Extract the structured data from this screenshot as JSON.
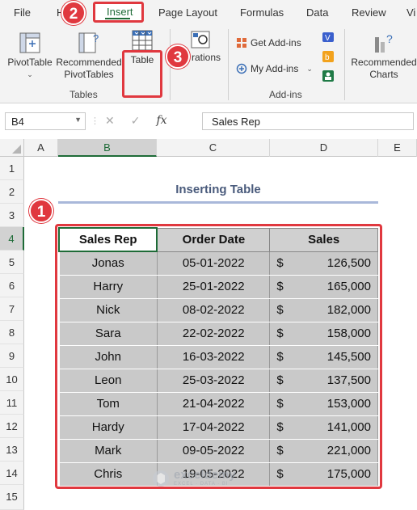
{
  "ribbon_tabs": {
    "file": "File",
    "home_partial": "H",
    "insert": "Insert",
    "page_layout": "Page Layout",
    "formulas": "Formulas",
    "data": "Data",
    "review": "Review",
    "view_partial": "Vi"
  },
  "ribbon": {
    "pivottable": "PivotTable",
    "recommended_pivottables_1": "Recommended",
    "recommended_pivottables_2": "PivotTables",
    "table": "Table",
    "illustrations_partial": "rations",
    "get_addins": "Get Add-ins",
    "my_addins": "My Add-ins",
    "recommended_charts_1": "Recommended",
    "recommended_charts_2": "Charts",
    "group_tables": "Tables",
    "group_addins": "Add-ins"
  },
  "badges": {
    "b1": "1",
    "b2": "2",
    "b3": "3"
  },
  "formula_bar": {
    "name_box": "B4",
    "fx": "fx",
    "content": "Sales Rep"
  },
  "columns": [
    "A",
    "B",
    "C",
    "D",
    "E"
  ],
  "rows": [
    "1",
    "2",
    "3",
    "4",
    "5",
    "6",
    "7",
    "8",
    "9",
    "10",
    "11",
    "12",
    "13",
    "14",
    "15"
  ],
  "sheet": {
    "title": "Inserting Table",
    "headers": [
      "Sales Rep",
      "Order Date",
      "Sales"
    ],
    "records": [
      {
        "rep": "Jonas",
        "date": "05-01-2022",
        "cur": "$",
        "amt": "126,500"
      },
      {
        "rep": "Harry",
        "date": "25-01-2022",
        "cur": "$",
        "amt": "165,000"
      },
      {
        "rep": "Nick",
        "date": "08-02-2022",
        "cur": "$",
        "amt": "182,000"
      },
      {
        "rep": "Sara",
        "date": "22-02-2022",
        "cur": "$",
        "amt": "158,000"
      },
      {
        "rep": "John",
        "date": "16-03-2022",
        "cur": "$",
        "amt": "145,500"
      },
      {
        "rep": "Leon",
        "date": "25-03-2022",
        "cur": "$",
        "amt": "137,500"
      },
      {
        "rep": "Tom",
        "date": "21-04-2022",
        "cur": "$",
        "amt": "153,000"
      },
      {
        "rep": "Hardy",
        "date": "17-04-2022",
        "cur": "$",
        "amt": "141,000"
      },
      {
        "rep": "Mark",
        "date": "09-05-2022",
        "cur": "$",
        "amt": "221,000"
      },
      {
        "rep": "Chris",
        "date": "19-05-2022",
        "cur": "$",
        "amt": "175,000"
      }
    ]
  },
  "watermark": {
    "name": "exceldemy",
    "sub": "EXCEL · DATA · BI"
  },
  "colors": {
    "accent_green": "#1e6b37",
    "highlight_red": "#e0383f",
    "title_blue": "#4a5b7c"
  }
}
